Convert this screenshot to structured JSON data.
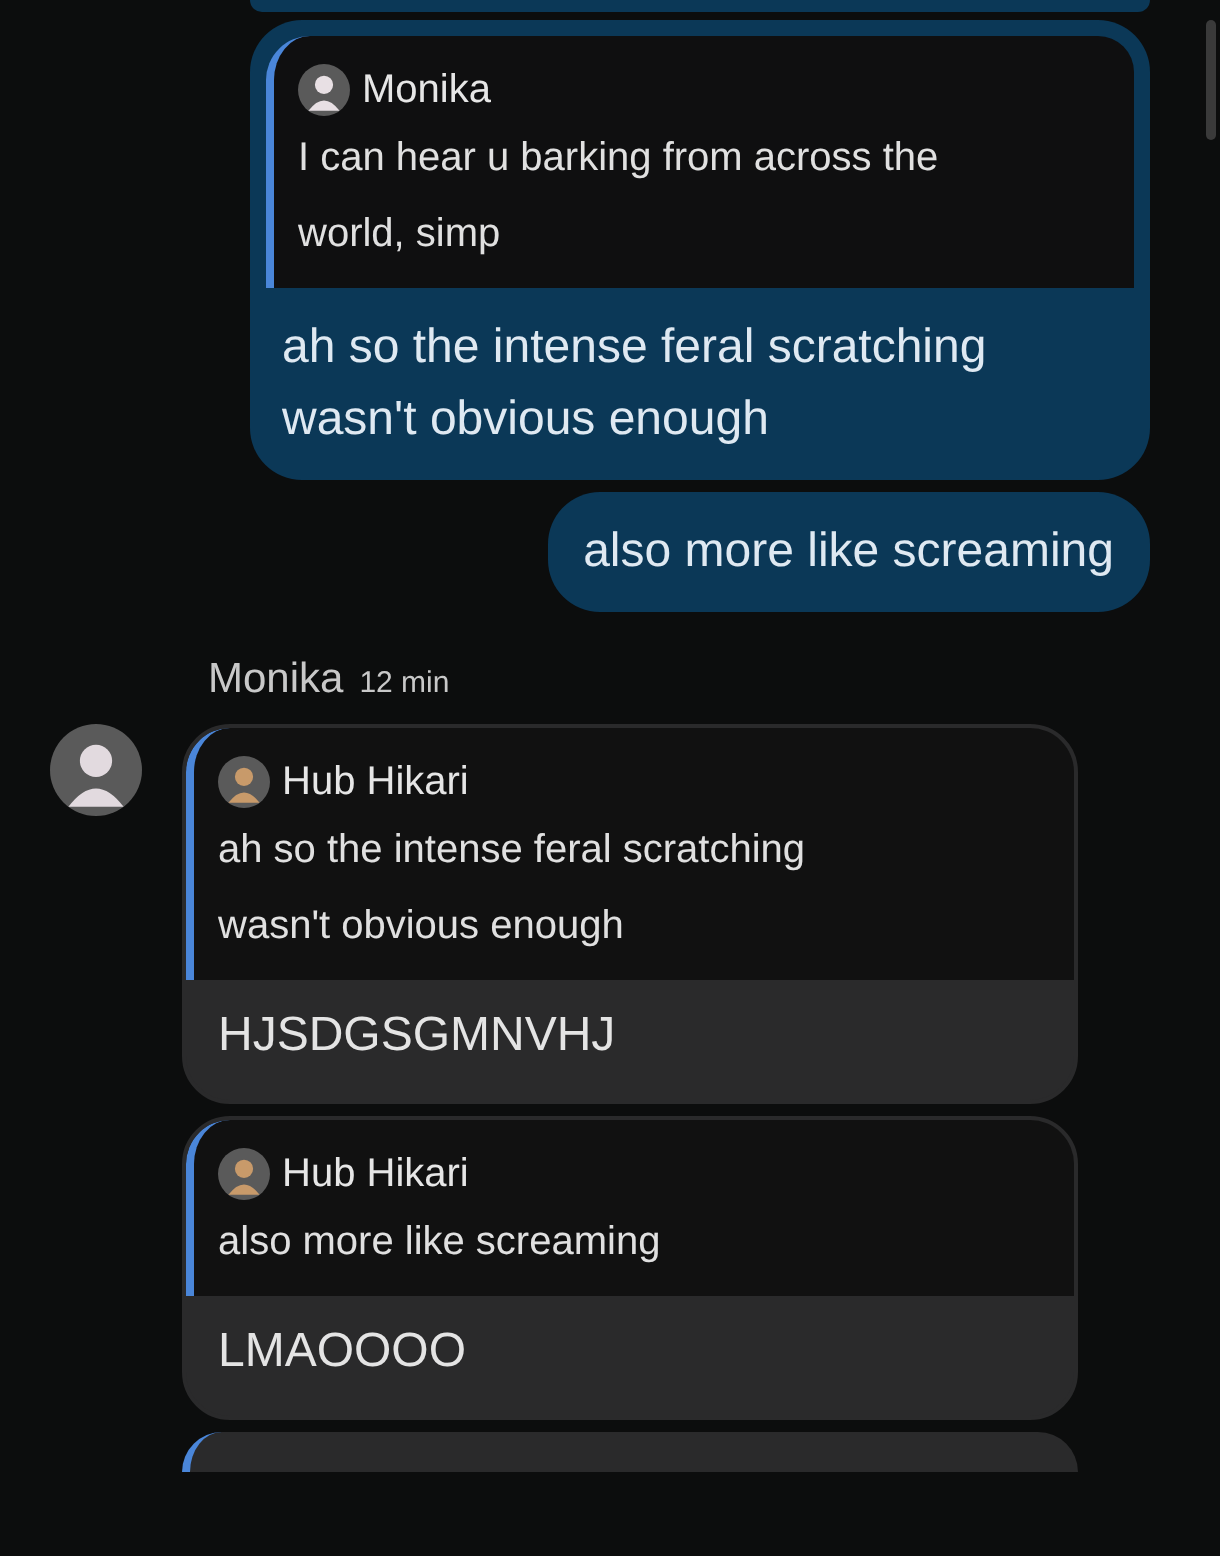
{
  "outgoing": [
    {
      "quote": {
        "author": "Monika",
        "text": "I can hear u barking from across the world, simp"
      },
      "text": "ah so the intense feral scratching wasn't obvious enough"
    },
    {
      "text": "also more like screaming"
    }
  ],
  "incoming": {
    "sender": "Monika",
    "time": "12 min",
    "messages": [
      {
        "quote": {
          "author": "Hub Hikari",
          "text": "ah so the intense feral scratching wasn't obvious enough"
        },
        "text": "HJSDGSGMNVHJ"
      },
      {
        "quote": {
          "author": "Hub Hikari",
          "text": "also more like screaming"
        },
        "text": "LMAOOOO"
      }
    ]
  }
}
